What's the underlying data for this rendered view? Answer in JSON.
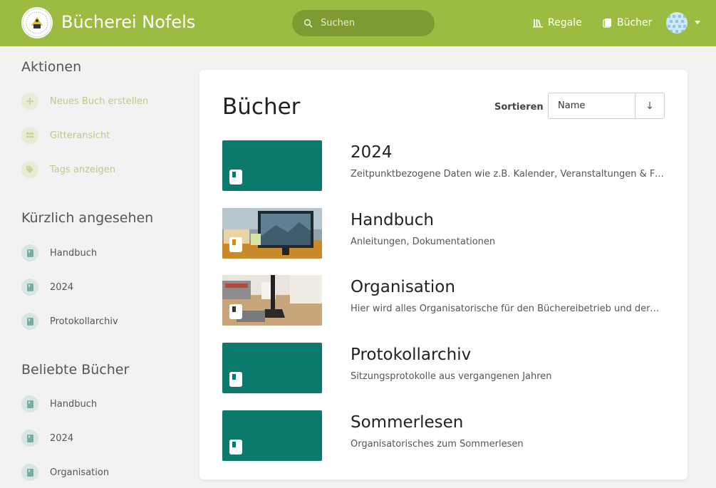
{
  "app": {
    "title": "Bücherei Nofels",
    "colors": {
      "header": "#9bbc41",
      "book_accent": "#0b7a6c"
    }
  },
  "header": {
    "search_placeholder": "Suchen",
    "nav": [
      {
        "label": "Regale",
        "icon": "shelves-icon"
      },
      {
        "label": "Bücher",
        "icon": "books-icon"
      }
    ]
  },
  "sidebar": {
    "actions_heading": "Aktionen",
    "actions": [
      {
        "label": "Neues Buch erstellen",
        "icon": "plus-icon"
      },
      {
        "label": "Gitteransicht",
        "icon": "grid-icon"
      },
      {
        "label": "Tags anzeigen",
        "icon": "tag-icon"
      }
    ],
    "recent_heading": "Kürzlich angesehen",
    "recent": [
      {
        "label": "Handbuch"
      },
      {
        "label": "2024"
      },
      {
        "label": "Protokollarchiv"
      }
    ],
    "popular_heading": "Beliebte Bücher",
    "popular": [
      {
        "label": "Handbuch"
      },
      {
        "label": "2024"
      },
      {
        "label": "Organisation"
      }
    ]
  },
  "main": {
    "title": "Bücher",
    "sort_label": "Sortieren",
    "sort_value": "Name",
    "sort_direction": "↓",
    "books": [
      {
        "name": "2024",
        "description": "Zeitpunktbezogene Daten wie z.B. Kalender, Veranstaltungen & Fortbildungen"
      },
      {
        "name": "Handbuch",
        "description": "Anleitungen, Dokumentationen"
      },
      {
        "name": "Organisation",
        "description": "Hier wird alles Organisatorische für den Büchereibetrieb und deren Abläufe"
      },
      {
        "name": "Protokollarchiv",
        "description": "Sitzungsprotokolle aus vergangenen Jahren"
      },
      {
        "name": "Sommerlesen",
        "description": "Organisatorisches zum Sommerlesen"
      }
    ]
  }
}
